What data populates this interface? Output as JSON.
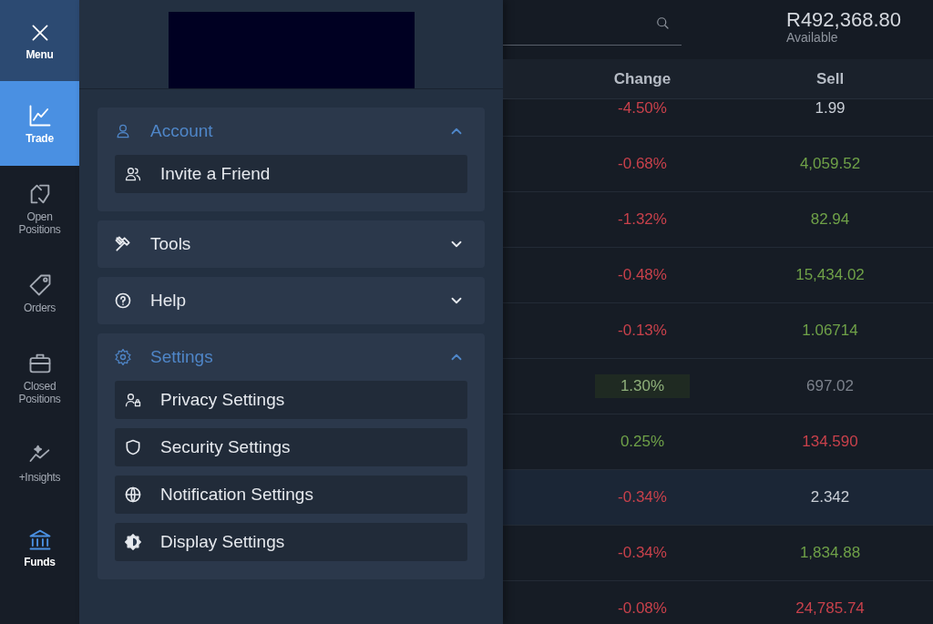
{
  "nav": [
    {
      "label": "Menu",
      "kind": "close",
      "selected": false,
      "accent": false
    },
    {
      "label": "Trade",
      "kind": "item",
      "selected": true,
      "accent": false
    },
    {
      "label": "Open Positions",
      "kind": "item",
      "selected": false,
      "accent": false
    },
    {
      "label": "Orders",
      "kind": "item",
      "selected": false,
      "accent": false
    },
    {
      "label": "Closed Positions",
      "kind": "item",
      "selected": false,
      "accent": false
    },
    {
      "label": "+Insights",
      "kind": "item",
      "selected": false,
      "accent": false
    },
    {
      "label": "Funds",
      "kind": "item",
      "selected": false,
      "accent": true
    }
  ],
  "menu": {
    "sections": [
      {
        "title": "Account",
        "expanded": true,
        "children": [
          {
            "label": "Invite a Friend"
          }
        ]
      },
      {
        "title": "Tools",
        "expanded": false
      },
      {
        "title": "Help",
        "expanded": false
      },
      {
        "title": "Settings",
        "expanded": true,
        "children": [
          {
            "label": "Privacy Settings"
          },
          {
            "label": "Security Settings"
          },
          {
            "label": "Notification Settings"
          },
          {
            "label": "Display Settings"
          }
        ]
      }
    ]
  },
  "balance": {
    "amount": "R492,368.80",
    "label": "Available"
  },
  "table": {
    "columns": [
      "Change",
      "Sell"
    ],
    "rows": [
      {
        "selected": false,
        "cells": [
          {
            "text": "-4.50%",
            "color": "#c8414b",
            "flash": false
          },
          {
            "text": "1.99",
            "color": "#c9ced6",
            "flash": false
          }
        ]
      },
      {
        "selected": false,
        "cells": [
          {
            "text": "-0.68%",
            "color": "#c8414b",
            "flash": false
          },
          {
            "text": "4,059.52",
            "color": "#6fa148",
            "flash": false
          }
        ]
      },
      {
        "selected": false,
        "cells": [
          {
            "text": "-1.32%",
            "color": "#c8414b",
            "flash": false
          },
          {
            "text": "82.94",
            "color": "#6fa148",
            "flash": false
          }
        ]
      },
      {
        "selected": false,
        "cells": [
          {
            "text": "-0.48%",
            "color": "#c8414b",
            "flash": false
          },
          {
            "text": "15,434.02",
            "color": "#6fa148",
            "flash": false
          }
        ]
      },
      {
        "selected": false,
        "cells": [
          {
            "text": "-0.13%",
            "color": "#c8414b",
            "flash": false
          },
          {
            "text": "1.06714",
            "color": "#6fa148",
            "flash": false
          }
        ]
      },
      {
        "selected": false,
        "cells": [
          {
            "text": "1.30%",
            "color": "#8fb07a",
            "flash": true
          },
          {
            "text": "697.02",
            "color": "#7c828c",
            "flash": false
          }
        ]
      },
      {
        "selected": false,
        "cells": [
          {
            "text": "0.25%",
            "color": "#6fa148",
            "flash": false
          },
          {
            "text": "134.590",
            "color": "#c8414b",
            "flash": false
          }
        ]
      },
      {
        "selected": true,
        "cells": [
          {
            "text": "-0.34%",
            "color": "#c8414b",
            "flash": false
          },
          {
            "text": "2.342",
            "color": "#c9ced6",
            "flash": false
          }
        ]
      },
      {
        "selected": false,
        "cells": [
          {
            "text": "-0.34%",
            "color": "#c8414b",
            "flash": false
          },
          {
            "text": "1,834.88",
            "color": "#6fa148",
            "flash": false
          }
        ]
      },
      {
        "selected": false,
        "cells": [
          {
            "text": "-0.08%",
            "color": "#c8414b",
            "flash": false
          },
          {
            "text": "24,785.74",
            "color": "#c8414b",
            "flash": false
          }
        ]
      }
    ]
  }
}
